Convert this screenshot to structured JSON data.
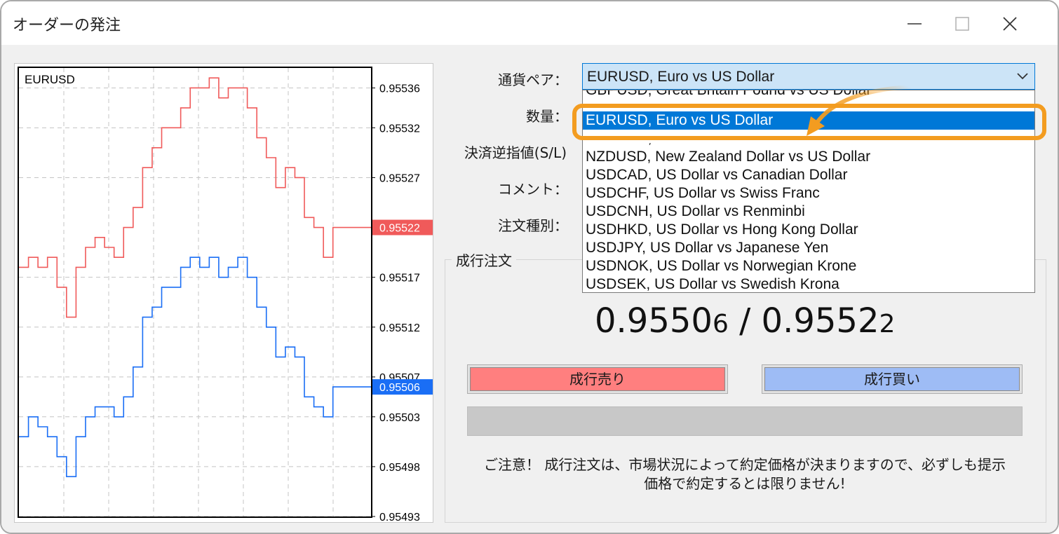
{
  "window": {
    "title": "オーダーの発注"
  },
  "chart": {
    "symbol": "EURUSD",
    "y_ticks": [
      "0.95536",
      "0.95532",
      "0.95527",
      "0.95517",
      "0.95512",
      "0.95507",
      "0.95503",
      "0.95498",
      "0.95493"
    ],
    "ask_label": "0.95522",
    "bid_label": "0.95506",
    "ask_color": "#f05a5a",
    "bid_color": "#1a6ef5"
  },
  "chart_data": {
    "type": "line",
    "title": "EURUSD",
    "xlabel": "",
    "ylabel": "",
    "ylim": [
      0.95493,
      0.95538
    ],
    "grid": true,
    "y_axis_position": "right",
    "series": [
      {
        "color": "#f05a5a",
        "values": [
          0.95518,
          0.95519,
          0.95518,
          0.95519,
          0.95516,
          0.95513,
          0.95518,
          0.9552,
          0.95521,
          0.9552,
          0.95519,
          0.95522,
          0.95524,
          0.95528,
          0.9553,
          0.95532,
          0.95532,
          0.95534,
          0.95536,
          0.95536,
          0.95537,
          0.95535,
          0.95536,
          0.95536,
          0.95534,
          0.95531,
          0.95529,
          0.95526,
          0.95528,
          0.95527,
          0.95523,
          0.95522,
          0.95519,
          0.95522,
          0.95522,
          0.95522,
          0.95522,
          0.95522
        ]
      },
      {
        "color": "#1a6ef5",
        "values": [
          0.95501,
          0.95503,
          0.95502,
          0.95501,
          0.95499,
          0.95497,
          0.95501,
          0.95503,
          0.95504,
          0.95504,
          0.95503,
          0.95505,
          0.95508,
          0.95513,
          0.95514,
          0.95516,
          0.95516,
          0.95518,
          0.95519,
          0.95518,
          0.95519,
          0.95517,
          0.95518,
          0.95519,
          0.95517,
          0.95514,
          0.95512,
          0.95509,
          0.9551,
          0.95509,
          0.95505,
          0.95504,
          0.95503,
          0.95506,
          0.95506,
          0.95506,
          0.95506,
          0.95506
        ]
      }
    ]
  },
  "form": {
    "symbol_label": "通貨ペア：",
    "volume_label": "数量：",
    "sl_label": "決済逆指値(S/L)",
    "comment_label": "コメント：",
    "type_label": "注文種別：",
    "symbol_value": "EURUSD, Euro vs US Dollar"
  },
  "dropdown": {
    "items": [
      "GBPUSD, Great Britain Pound vs US Dollar",
      "EURUSD, Euro vs US Dollar",
      "GBPUSD, Great Britain Pound vs US Dollar",
      "NZDUSD, New Zealand Dollar vs US Dollar",
      "USDCAD, US Dollar vs Canadian Dollar",
      "USDCHF, US Dollar vs Swiss Franc",
      "USDCNH, US Dollar vs Renminbi",
      "USDHKD, US Dollar vs Hong Kong Dollar",
      "USDJPY, US Dollar vs Japanese Yen",
      "USDNOK, US Dollar vs Norwegian Krone",
      "USDSEK, US Dollar vs Swedish Krona"
    ],
    "selected_color": "#0078d7",
    "highlight_color": "#f39c20"
  },
  "market": {
    "group_title": "成行注文",
    "bid_main": "0.9550",
    "bid_small": "6",
    "separator": " / ",
    "ask_main": "0.9552",
    "ask_small": "2",
    "sell_label": "成行売り",
    "buy_label": "成行買い",
    "sell_color": "#ff7f7f",
    "buy_color": "#9ebcf5",
    "notice_line1": "ご注意！ 成行注文は、市場状況によって約定価格が決まりますので、必ずしも提示",
    "notice_line2": "価格で約定するとは限りません!"
  }
}
